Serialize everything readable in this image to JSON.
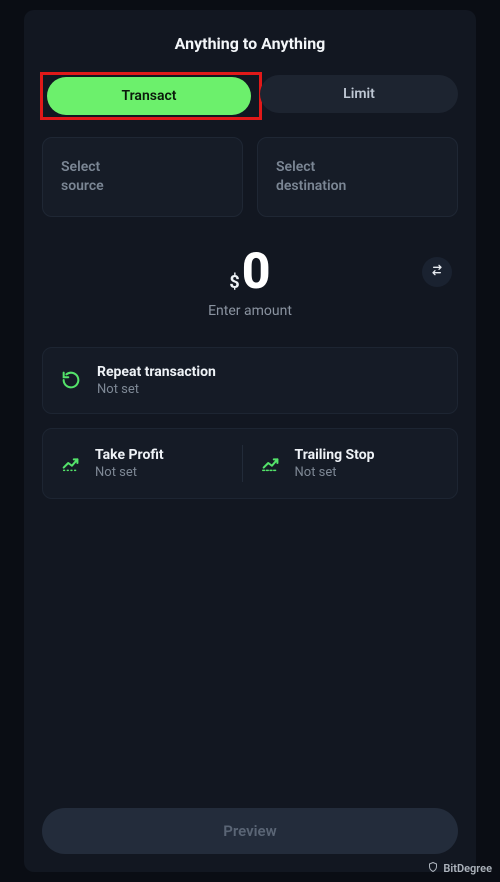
{
  "title": "Anything to Anything",
  "tabs": {
    "transact": "Transact",
    "limit": "Limit"
  },
  "source": {
    "label_line1": "Select",
    "label_line2": "source"
  },
  "destination": {
    "label_line1": "Select",
    "label_line2": "destination"
  },
  "amount": {
    "currency": "$",
    "value": "0",
    "placeholder": "Enter amount"
  },
  "options": {
    "repeat": {
      "title": "Repeat transaction",
      "status": "Not set"
    },
    "take_profit": {
      "title": "Take Profit",
      "status": "Not set"
    },
    "trailing_stop": {
      "title": "Trailing Stop",
      "status": "Not set"
    }
  },
  "preview_button": "Preview",
  "watermark": "BitDegree"
}
